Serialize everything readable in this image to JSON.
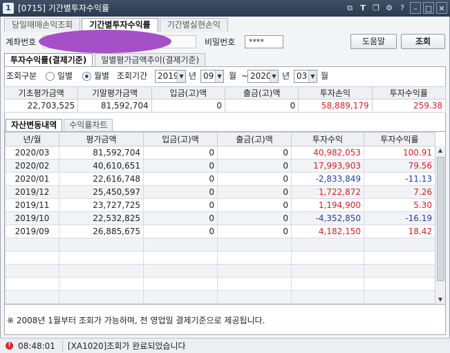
{
  "window": {
    "app_icon": "1",
    "title": "[0715] 기간별투자수익률",
    "buttons": [
      "link-icon",
      "text-icon",
      "copy-icon",
      "settings-icon",
      "help-icon",
      "minimize-icon",
      "maximize-icon",
      "close-icon"
    ]
  },
  "top_tabs": [
    {
      "label": "당일매매손익조회",
      "active": false
    },
    {
      "label": "기간별투자수익률",
      "active": true
    },
    {
      "label": "기간별실현손익",
      "active": false
    }
  ],
  "account": {
    "account_label": "계좌번호",
    "password_label": "비밀번호",
    "password_value": "****",
    "help_button": "도움말",
    "query_button": "조회"
  },
  "sub_tabs": [
    {
      "label": "투자수익률(결제기준)",
      "active": true
    },
    {
      "label": "일별평가금액추이(결제기준)",
      "active": false
    }
  ],
  "query": {
    "type_label": "조회구분",
    "options": [
      "일별",
      "월별"
    ],
    "selected": "월별",
    "period_label": "조회기간",
    "from_year": "2019",
    "year_unit": "년",
    "from_month": "09",
    "month_unit": "월",
    "tilde": "~",
    "to_year": "2020",
    "to_month": "03"
  },
  "summary": {
    "headers": [
      "기초평가금액",
      "기말평가금액",
      "입금(고)액",
      "출금(고)액",
      "투자손익",
      "투자수익률"
    ],
    "values": [
      "22,703,525",
      "81,592,704",
      "0",
      "0",
      "58,889,179",
      "259.38"
    ]
  },
  "asset_tabs": [
    {
      "label": "자산변동내역",
      "active": true
    },
    {
      "label": "수익률차트",
      "active": false
    }
  ],
  "grid": {
    "headers": [
      "년/월",
      "평가금액",
      "입금(고)액",
      "출금(고)액",
      "투자수익",
      "투자수익률"
    ],
    "rows": [
      [
        "2020/03",
        "81,592,704",
        "0",
        "0",
        "40,982,053",
        "100.91"
      ],
      [
        "2020/02",
        "40,610,651",
        "0",
        "0",
        "17,993,903",
        "79.56"
      ],
      [
        "2020/01",
        "22,616,748",
        "0",
        "0",
        "-2,833,849",
        "-11.13"
      ],
      [
        "2019/12",
        "25,450,597",
        "0",
        "0",
        "1,722,872",
        "7.26"
      ],
      [
        "2019/11",
        "23,727,725",
        "0",
        "0",
        "1,194,900",
        "5.30"
      ],
      [
        "2019/10",
        "22,532,825",
        "0",
        "0",
        "-4,352,850",
        "-16.19"
      ],
      [
        "2019/09",
        "26,885,675",
        "0",
        "0",
        "4,182,150",
        "18.42"
      ]
    ],
    "empty_rows": 5
  },
  "notice": "※ 2008년 1월부터 조회가 가능하며, 전 영업일 결제기준으로 제공됩니다.",
  "status": {
    "time": "08:48:01",
    "message": "[XA1020]조회가 완료되었습니다"
  },
  "colors": {
    "positive": "#d0202a",
    "negative": "#1f3f9e",
    "titlebar": "#2c3a4e",
    "mask": "#a650c8"
  }
}
